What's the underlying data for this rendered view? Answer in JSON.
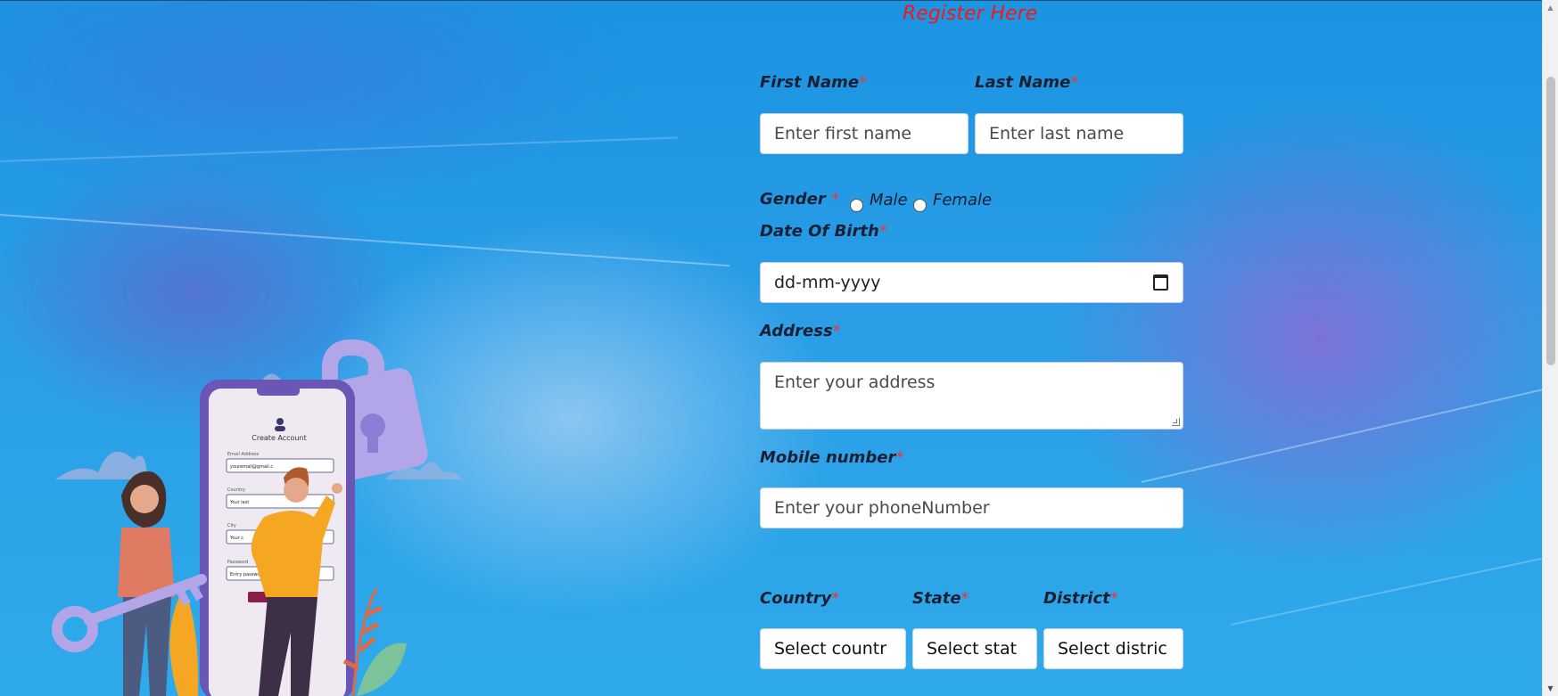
{
  "form": {
    "title": "Register Here",
    "first_name": {
      "label": "First Name",
      "required": "*",
      "placeholder": "Enter first name"
    },
    "last_name": {
      "label": "Last Name",
      "required": "*",
      "placeholder": "Enter last name"
    },
    "gender": {
      "label": "Gender",
      "required": "*",
      "options": [
        "Male",
        "Female"
      ]
    },
    "dob": {
      "label": "Date Of Birth",
      "required": "*",
      "placeholder": "dd-mm-yyyy"
    },
    "address": {
      "label": "Address",
      "required": "*",
      "placeholder": "Enter your address"
    },
    "mobile": {
      "label": "Mobile number",
      "required": "*",
      "placeholder": "Enter your phoneNumber"
    },
    "country": {
      "label": "Country",
      "required": "*",
      "placeholder": "Select countr"
    },
    "state": {
      "label": "State",
      "required": "*",
      "placeholder": "Select stat"
    },
    "district": {
      "label": "District",
      "required": "*",
      "placeholder": "Select distric"
    }
  },
  "illustration": {
    "screen_title": "Create Account",
    "email_label": "Email Address",
    "email_value": "youremail@gmail.c",
    "country_label": "Country",
    "country_value": "Your last",
    "city_label": "City",
    "city_value": "Your c",
    "password_label": "Password",
    "password_value": "Entry password"
  },
  "colors": {
    "accent_required": "#e8373c",
    "title": "#ee1a1a",
    "illustration_purple": "#6b55b5",
    "illustration_lavender": "#b3a6e8"
  },
  "icons": [
    "calendar-icon",
    "lock-icon",
    "key-icon",
    "user-icon",
    "scroll-up-icon",
    "scroll-down-icon"
  ]
}
